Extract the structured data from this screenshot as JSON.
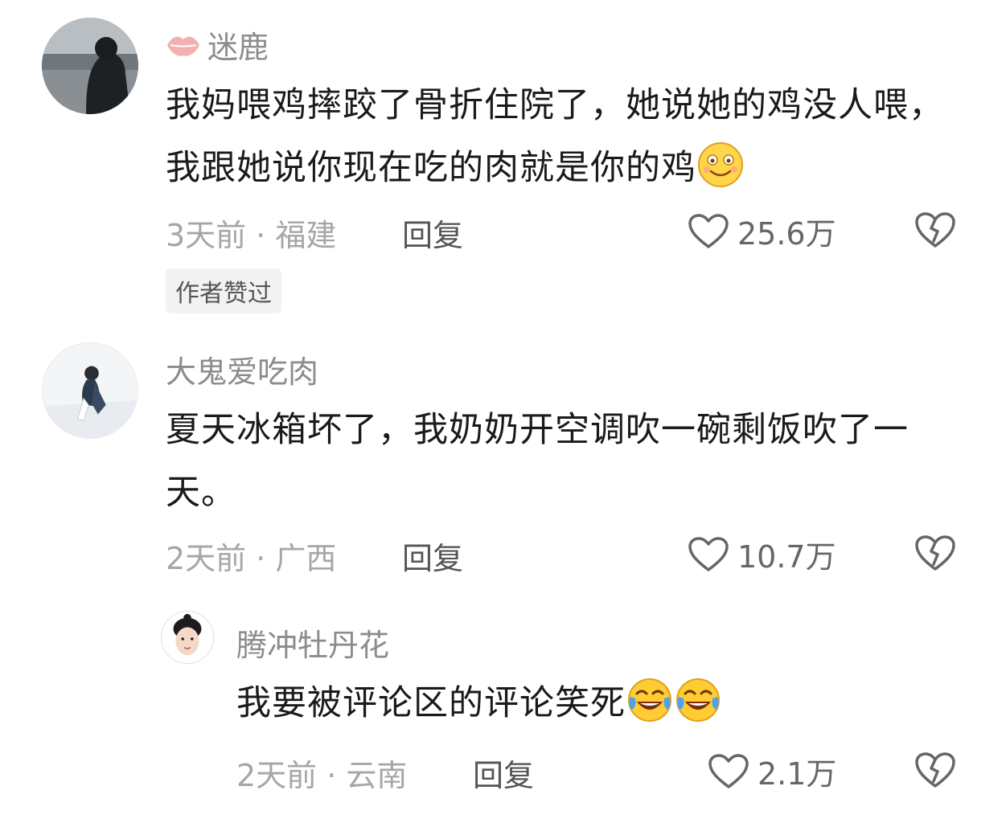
{
  "comments": [
    {
      "username": "迷鹿",
      "text": "我妈喂鸡摔跤了骨折住院了，她说她的鸡没人喂，我跟她说你现在吃的肉就是你的鸡",
      "emoji": "smile-emoji",
      "time_location": "3天前 · 福建",
      "reply_label": "回复",
      "likes": "25.6万",
      "badge": "作者赞过"
    },
    {
      "username": "大鬼爱吃肉",
      "text": "夏天冰箱坏了，我奶奶开空调吹一碗剩饭吹了一天。",
      "time_location": "2天前 · 广西",
      "reply_label": "回复",
      "likes": "10.7万"
    },
    {
      "username": "腾冲牡丹花",
      "text": "我要被评论区的评论笑死",
      "emoji": "laughing-tears-emoji",
      "time_location": "2天前 · 云南",
      "reply_label": "回复",
      "likes": "2.1万"
    }
  ],
  "colors": {
    "username": "#8c8c8c",
    "text": "#1a1a1a",
    "meta": "#a6a6a6",
    "badge_bg": "#f2f2f2",
    "lips": "#f0a0a0"
  }
}
